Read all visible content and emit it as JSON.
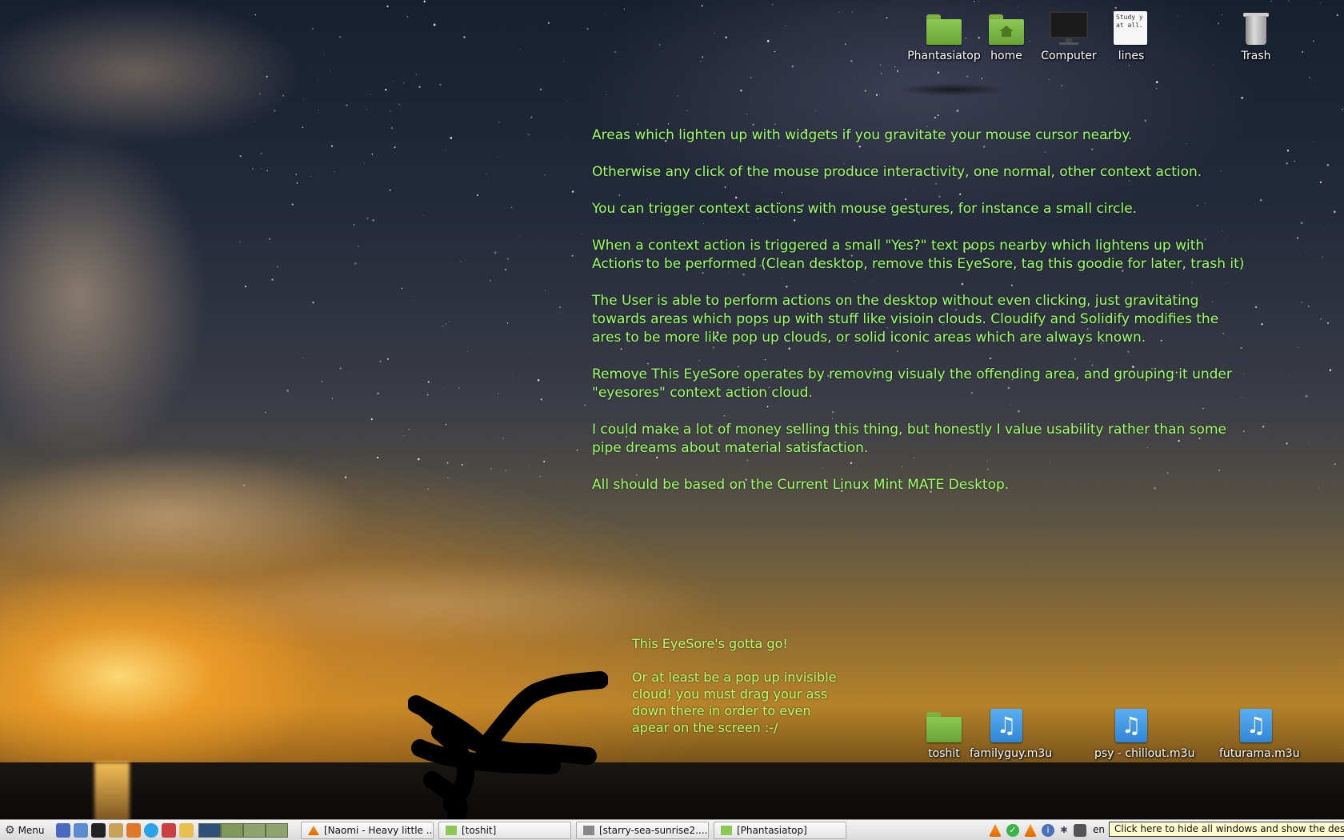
{
  "desktop": {
    "top_icons": [
      {
        "label": "Phantasiatop",
        "type": "folder-icon"
      },
      {
        "label": "home",
        "type": "home-folder-icon"
      },
      {
        "label": "Computer",
        "type": "computer-icon"
      },
      {
        "label": "lines",
        "type": "text-file-icon",
        "preview": "Study y\nat all."
      },
      {
        "label": "Trash",
        "type": "trash-icon"
      }
    ],
    "bottom_icons": [
      {
        "label": "toshit",
        "type": "folder-icon"
      },
      {
        "label": "familyguy.m3u",
        "type": "music-playlist-icon"
      },
      {
        "label": "psy - chillout.m3u",
        "type": "music-playlist-icon"
      },
      {
        "label": "futurama.m3u",
        "type": "music-playlist-icon"
      }
    ],
    "notes": [
      "Areas which lighten up with widgets if you gravitate your mouse cursor nearby.",
      "Otherwise any click of the mouse produce interactivity, one normal, other context action.",
      "You can trigger context actions with mouse gestures, for instance a small circle.",
      "When a context action is triggered a small \"Yes?\" text pops nearby which lightens up with Actions to be performed (Clean desktop, remove this EyeSore, tag this goodie for later, trash it)",
      "The User is able to perform actions on the desktop without even clicking, just gravitating towards areas which pops up with stuff like visioin clouds. Cloudify and Solidify modifies the ares to be more like pop up clouds, or solid iconic areas which are always known.",
      "Remove This EyeSore operates by removing visualy the offending area, and grouping it under \"eyesores\" context action cloud.",
      "I could make a lot of money selling this thing, but honestly I value usability rather than some pipe dreams about material satisfaction.",
      "All should be based on the Current Linux Mint MATE Desktop."
    ],
    "eyesore_note": {
      "line1": "This EyeSore's gotta go!",
      "line2": "Or at least be a pop up invisible cloud! you must drag your ass down there in order to even apear on the screen :-/"
    },
    "colors": {
      "note_text": "#9dff66",
      "eyesore_text": "#b8ff70"
    }
  },
  "taskbar": {
    "menu_label": "Menu",
    "tasks": [
      {
        "label": "[Naomi - Heavy little ...",
        "icon": "vlc-icon"
      },
      {
        "label": "[toshit]",
        "icon": "folder-icon"
      },
      {
        "label": "[starry-sea-sunrise2....",
        "icon": "image-viewer-icon"
      },
      {
        "label": "[Phantasiatop]",
        "icon": "folder-icon"
      }
    ],
    "keyboard_layout": "en",
    "show_desktop_tooltip": "Click here to hide all windows and show the desktop."
  }
}
